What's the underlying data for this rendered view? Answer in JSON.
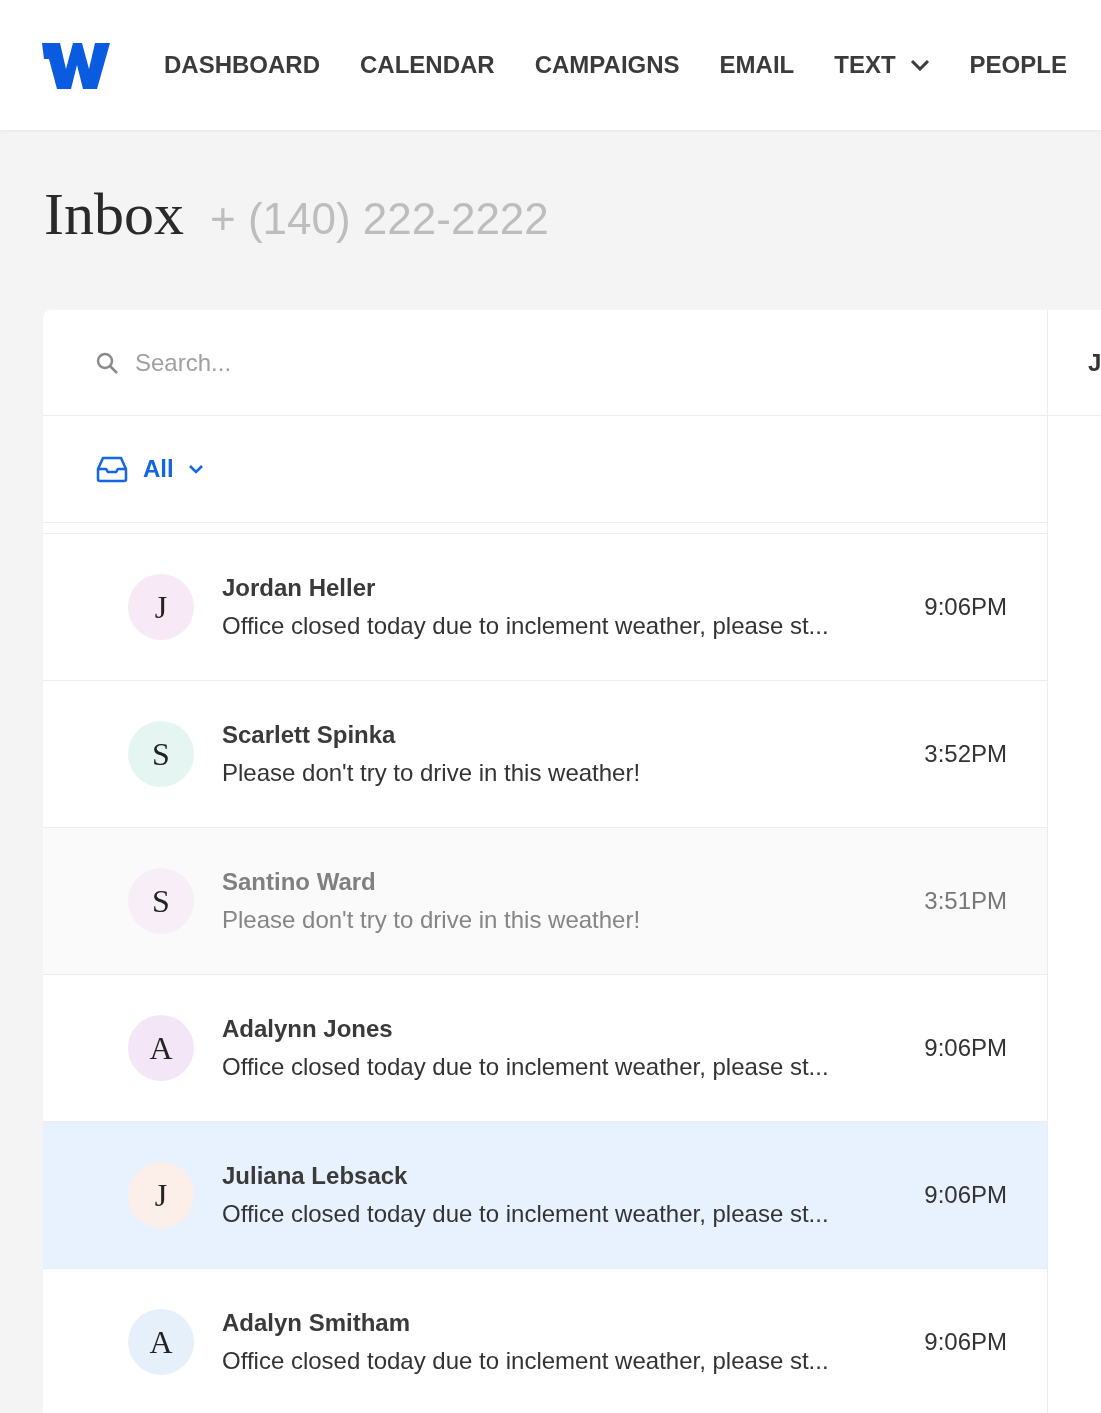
{
  "nav": {
    "items": [
      {
        "label": "DASHBOARD",
        "dropdown": false
      },
      {
        "label": "CALENDAR",
        "dropdown": false
      },
      {
        "label": "CAMPAIGNS",
        "dropdown": false
      },
      {
        "label": "EMAIL",
        "dropdown": false
      },
      {
        "label": "TEXT",
        "dropdown": true
      },
      {
        "label": "PEOPLE",
        "dropdown": false
      }
    ]
  },
  "page": {
    "title": "Inbox",
    "phone": "+ (140) 222-2222"
  },
  "search": {
    "placeholder": "Search..."
  },
  "filter": {
    "label": "All"
  },
  "conversations": [
    {
      "initial": "J",
      "name": "Jordan Heller",
      "preview": "Office closed today due to inclement weather, please st...",
      "time": "9:06PM",
      "read": false,
      "selected": false,
      "color": "#f7e9f6"
    },
    {
      "initial": "S",
      "name": "Scarlett Spinka",
      "preview": "Please don't try to drive in this weather!",
      "time": "3:52PM",
      "read": false,
      "selected": false,
      "color": "#e5f5f2"
    },
    {
      "initial": "S",
      "name": "Santino Ward",
      "preview": "Please don't try to drive in this weather!",
      "time": "3:51PM",
      "read": true,
      "selected": false,
      "color": "#f8eef7"
    },
    {
      "initial": "A",
      "name": "Adalynn Jones",
      "preview": "Office closed today due to inclement weather, please st...",
      "time": "9:06PM",
      "read": false,
      "selected": false,
      "color": "#f3e6f7"
    },
    {
      "initial": "J",
      "name": "Juliana Lebsack",
      "preview": "Office closed today due to inclement weather, please st...",
      "time": "9:06PM",
      "read": false,
      "selected": true,
      "color": "#fcefe9"
    },
    {
      "initial": "A",
      "name": "Adalyn Smitham",
      "preview": "Office closed today due to inclement weather, please st...",
      "time": "9:06PM",
      "read": false,
      "selected": false,
      "color": "#e6f0fb"
    }
  ],
  "detail": {
    "header": "J"
  }
}
